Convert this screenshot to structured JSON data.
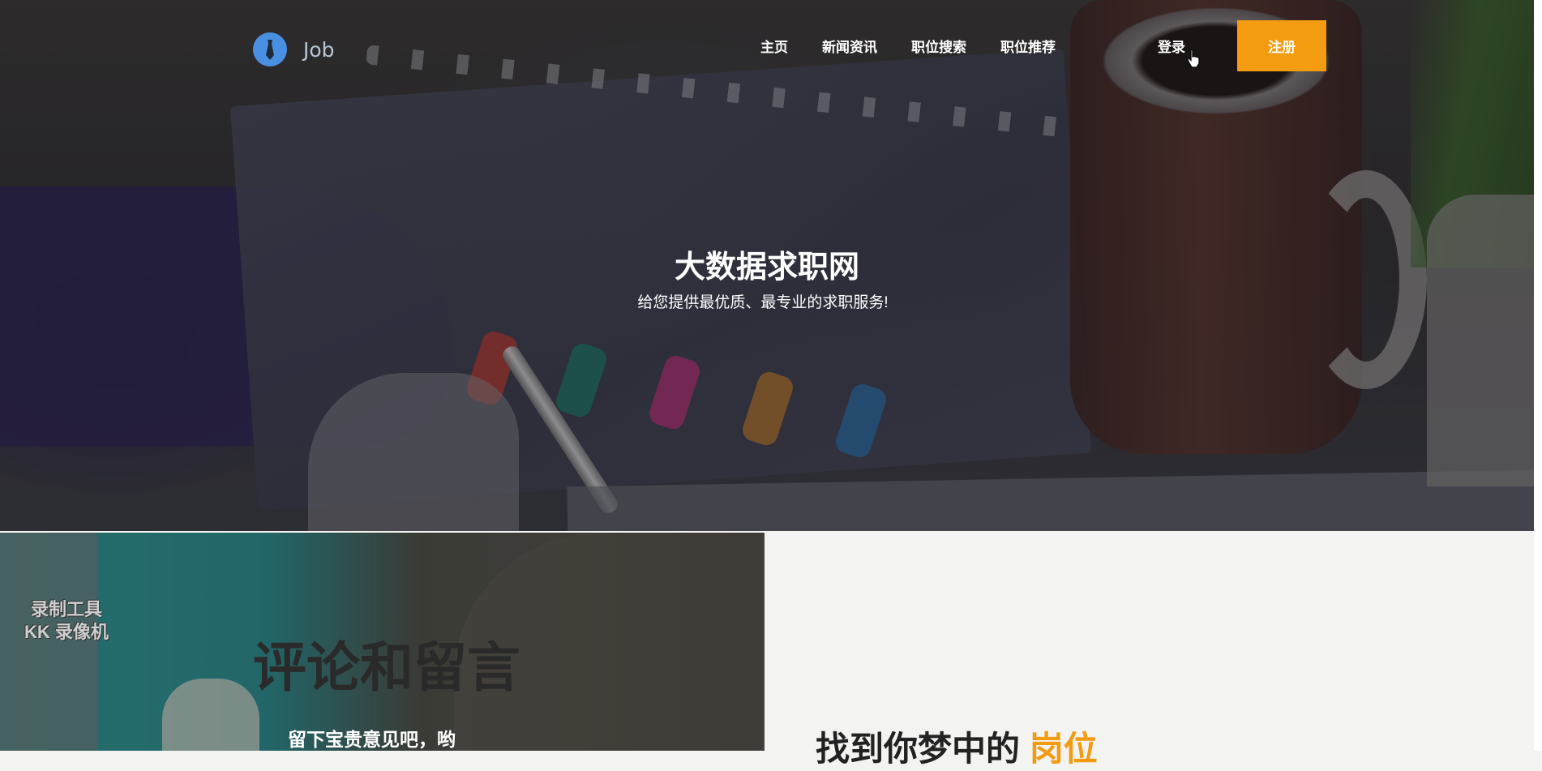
{
  "brand": {
    "name": "Job",
    "icon": "tie-icon",
    "icon_color": "#4a90e2"
  },
  "nav": {
    "items": [
      {
        "label": "主页"
      },
      {
        "label": "新闻资讯"
      },
      {
        "label": "职位搜索"
      },
      {
        "label": "职位推荐"
      }
    ],
    "login_label": "登录",
    "register_label": "注册",
    "register_color": "#f39c12"
  },
  "hero": {
    "title": "大数据求职网",
    "subtitle": "给您提供最优质、最专业的求职服务!"
  },
  "feature": {
    "watermark_line1": "录制工具",
    "watermark_line2": "KK 录像机",
    "title": "评论和留言",
    "subtitle": "留下宝贵意见吧，哟"
  },
  "dream": {
    "title_prefix": "找到你梦中的",
    "title_highlight": "岗位",
    "highlight_color": "#f39c12"
  }
}
